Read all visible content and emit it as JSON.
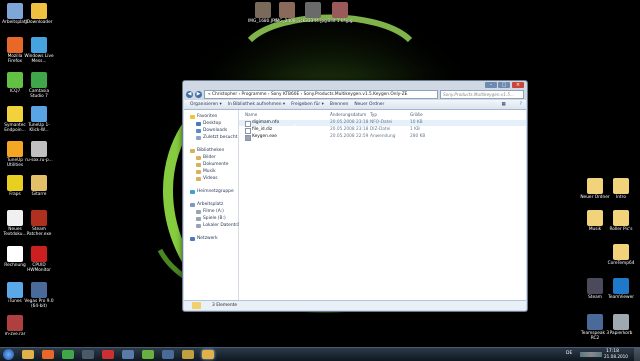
{
  "desktop": {
    "left_icons": [
      {
        "label": "Arbeitsplatz",
        "color": "#7fa6d8"
      },
      {
        "label": "JDownloader",
        "color": "#f0c040"
      },
      {
        "label": "Mozilla Firefox",
        "color": "#e8682a"
      },
      {
        "label": "Windows Live Mess...",
        "color": "#47a3e0"
      },
      {
        "label": "ICQ7",
        "color": "#62c043"
      },
      {
        "label": "Camtasia Studio 7",
        "color": "#3fa64a"
      },
      {
        "label": "Symantec Endpoin...",
        "color": "#f2d23c"
      },
      {
        "label": "TuneUp 1-Klick-W...",
        "color": "#59a4e4"
      },
      {
        "label": "TuneUp Utilities",
        "color": "#f5a623"
      },
      {
        "label": "ru-sox.ru-p...",
        "color": "#c0c0c0"
      },
      {
        "label": "Fraps",
        "color": "#e8d020"
      },
      {
        "label": "Gitarre",
        "color": "#e2c06a"
      },
      {
        "label": "Neues Textdoku...",
        "color": "#f0f0f0"
      },
      {
        "label": "Steam Patcher.exe",
        "color": "#b03020"
      },
      {
        "label": "Rechnung",
        "color": "#ffffff"
      },
      {
        "label": "CPUID HWMonitor",
        "color": "#cc2020"
      },
      {
        "label": "iTunes",
        "color": "#5aa8e8"
      },
      {
        "label": "Vegas Pro 9.0 (64-bit)",
        "color": "#4a6a9a"
      },
      {
        "label": "m-zve.rar",
        "color": "#b04040"
      }
    ],
    "top_icons": [
      {
        "label": "IMG_1680.JPG",
        "color": "#7a6a5a"
      },
      {
        "label": "IMG_2408...",
        "color": "#8a6a5a"
      },
      {
        "label": "ick33344.jpg",
        "color": "#6a6a6a"
      },
      {
        "label": "Bild 1.kf.jpg",
        "color": "#9a5a5a"
      }
    ],
    "right_icons": [
      {
        "label": "Neuer Ordner",
        "color": "#f2d27a"
      },
      {
        "label": "Intro",
        "color": "#f2d27a"
      },
      {
        "label": "Musik",
        "color": "#f2d27a"
      },
      {
        "label": "Roller Pic's",
        "color": "#f2d27a"
      },
      {
        "label": "CoreTemp64",
        "color": "#f2d27a"
      },
      {
        "label": "Steam",
        "color": "#4a4a5a"
      },
      {
        "label": "TeamViewer",
        "color": "#1f78c8"
      },
      {
        "label": "Teamspeak 3 RC2",
        "color": "#4a6a9a"
      },
      {
        "label": "Papierkorb",
        "color": "#a0a8b0"
      }
    ]
  },
  "explorer": {
    "breadcrumb": "« Christopher › Programme › Sony KTB60E › Sony.Products.Multikeygen.v1.5.Keygen.Only-ZE",
    "search_placeholder": "Sony.Products.Multikeygen.v1.5...",
    "toolbar": {
      "organize": "Organisieren ▾",
      "include": "In Bibliothek aufnehmen ▾",
      "share": "Freigeben für ▾",
      "burn": "Brennen",
      "new_folder": "Neuer Ordner"
    },
    "nav": {
      "favorites_title": "Favoriten",
      "favorites": [
        "Desktop",
        "Downloads",
        "Zuletzt besucht"
      ],
      "libraries_title": "Bibliotheken",
      "libraries": [
        "Bilder",
        "Dokumente",
        "Musik",
        "Videos"
      ],
      "homegroup": "Heimnetzgruppe",
      "computer_title": "Arbeitsplatz",
      "drives": [
        "Filme (A:)",
        "Spiele (B:)",
        "Lokaler Datenträger"
      ],
      "network": "Netzwerk"
    },
    "columns": {
      "name": "Name",
      "date": "Änderungsdatum",
      "type": "Typ",
      "size": "Größe"
    },
    "files": [
      {
        "name": "digimam.nfo",
        "date": "20.05.2008 23:18",
        "type": "NFO-Datei",
        "size": "10 KB",
        "icon_color": "#ffffff"
      },
      {
        "name": "file_id.diz",
        "date": "20.05.2008 23:18",
        "type": "DIZ-Datei",
        "size": "1 KB",
        "icon_color": "#ffffff"
      },
      {
        "name": "Keygen.exe",
        "date": "20.05.2008 22:59",
        "type": "Anwendung",
        "size": "280 KB",
        "icon_color": "#9aa4b0"
      }
    ],
    "status": "3 Elemente"
  },
  "taskbar": {
    "time": "17:18",
    "date": "21.08.2010",
    "lang": "DE"
  },
  "colors": {
    "accent": "#3d6ea8",
    "glow": "#7ee23a"
  }
}
